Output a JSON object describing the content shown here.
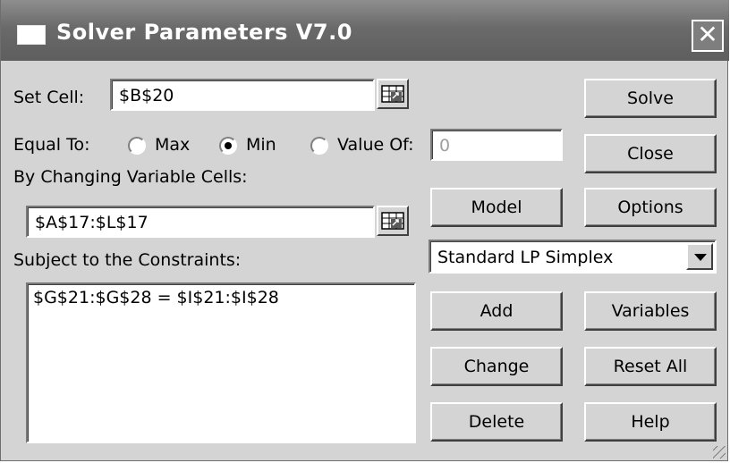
{
  "window": {
    "title": "Solver Parameters V7.0",
    "icons": {
      "app": "window-icon",
      "close": "close-icon"
    },
    "close_glyph": "✕"
  },
  "set_cell": {
    "label": "Set Cell:",
    "value": "$B$20"
  },
  "equal_to": {
    "label": "Equal To:",
    "options": [
      {
        "label": "Max",
        "checked": false
      },
      {
        "label": "Min",
        "checked": true
      },
      {
        "label": "Value Of:",
        "checked": false
      }
    ],
    "value_of_field": "0"
  },
  "changing_cells": {
    "label": "By Changing Variable Cells:",
    "value": "$A$17:$L$17"
  },
  "constraints": {
    "label": "Subject to the Constraints:",
    "items": [
      "$G$21:$G$28 = $I$21:$I$28"
    ]
  },
  "engine": {
    "selected": "Standard LP Simplex"
  },
  "buttons": {
    "solve": "Solve",
    "close": "Close",
    "model": "Model",
    "options": "Options",
    "add": "Add",
    "variables": "Variables",
    "change": "Change",
    "reset_all": "Reset All",
    "delete": "Delete",
    "help": "Help"
  },
  "colors": {
    "titlebar": "#6a6a6a",
    "dialog_bg": "#d4d4d4",
    "disabled_text": "#a0a0a0"
  }
}
